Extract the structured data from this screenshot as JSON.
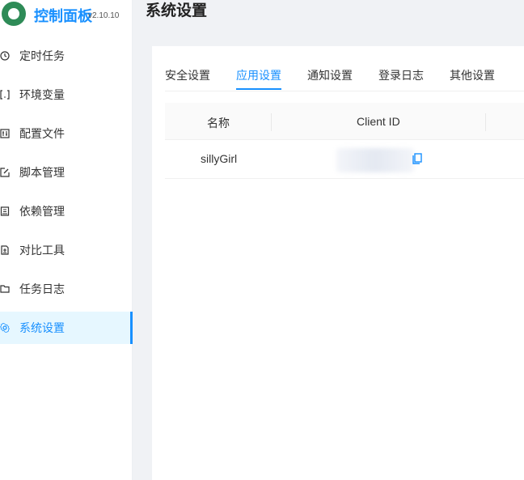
{
  "app": {
    "title": "控制面板",
    "version": "v2.10.10"
  },
  "sidebar": {
    "items": [
      {
        "label": "定时任务",
        "icon": "clock-icon"
      },
      {
        "label": "环境变量",
        "icon": "variable-icon"
      },
      {
        "label": "配置文件",
        "icon": "config-file-icon"
      },
      {
        "label": "脚本管理",
        "icon": "edit-icon"
      },
      {
        "label": "依赖管理",
        "icon": "package-icon"
      },
      {
        "label": "对比工具",
        "icon": "diff-icon"
      },
      {
        "label": "任务日志",
        "icon": "folder-icon"
      },
      {
        "label": "系统设置",
        "icon": "gear-icon",
        "active": true
      }
    ]
  },
  "header": {
    "title": "系统设置"
  },
  "tabs": [
    {
      "label": "安全设置"
    },
    {
      "label": "应用设置",
      "active": true
    },
    {
      "label": "通知设置"
    },
    {
      "label": "登录日志"
    },
    {
      "label": "其他设置"
    }
  ],
  "table": {
    "columns": [
      "名称",
      "Client ID"
    ],
    "rows": [
      {
        "name": "sillyGirl",
        "client_id": ""
      }
    ]
  },
  "colors": {
    "accent": "#1890ff",
    "active_bg": "#e6f7ff"
  }
}
